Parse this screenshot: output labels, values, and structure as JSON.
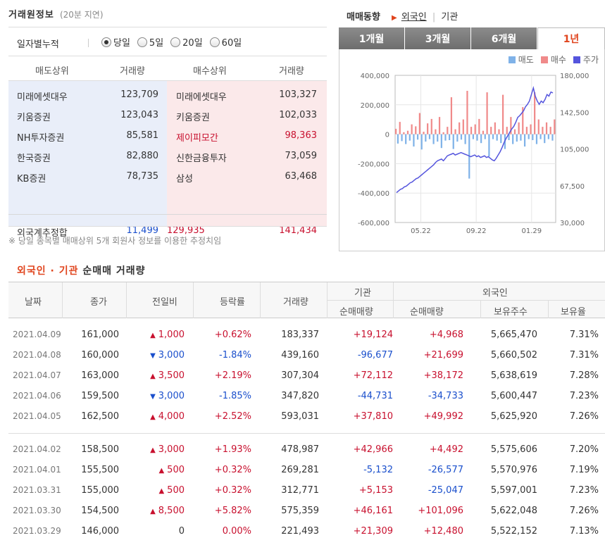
{
  "info": {
    "title": "거래원정보",
    "subtitle": "(20분 지연)",
    "period_label": "일자별누적",
    "periods": [
      {
        "label": "당일",
        "selected": true
      },
      {
        "label": "5일",
        "selected": false
      },
      {
        "label": "20일",
        "selected": false
      },
      {
        "label": "60일",
        "selected": false
      }
    ],
    "headers": {
      "sell": "매도상위",
      "sell_vol": "거래량",
      "buy": "매수상위",
      "buy_vol": "거래량"
    },
    "rows": [
      {
        "sell": "미래에셋대우",
        "sell_vol": "123,709",
        "buy": "미래에셋대우",
        "buy_vol": "103,327",
        "buy_foreign": false
      },
      {
        "sell": "키움증권",
        "sell_vol": "123,043",
        "buy": "키움증권",
        "buy_vol": "102,033",
        "buy_foreign": false
      },
      {
        "sell": "NH투자증권",
        "sell_vol": "85,581",
        "buy": "제이피모간",
        "buy_vol": "98,363",
        "buy_foreign": true
      },
      {
        "sell": "한국증권",
        "sell_vol": "82,880",
        "buy": "신한금융투자",
        "buy_vol": "73,059",
        "buy_foreign": false
      },
      {
        "sell": "KB증권",
        "sell_vol": "78,735",
        "buy": "삼성",
        "buy_vol": "63,468",
        "buy_foreign": false
      }
    ],
    "summary": {
      "label": "외국계추정합",
      "net": "11,499",
      "sell": "129,935",
      "buy": "141,434"
    },
    "note": "※ 당일 종목별 매매상위 5개 회원사 정보를 이용한 추정치임"
  },
  "trend": {
    "title": "매매동향",
    "link_foreign": "외국인",
    "link_inst": "기관",
    "tabs": [
      {
        "label": "1개월",
        "active": false
      },
      {
        "label": "3개월",
        "active": false
      },
      {
        "label": "6개월",
        "active": false
      },
      {
        "label": "1년",
        "active": true
      }
    ],
    "legend": [
      {
        "label": "매도",
        "color": "#7fb2e8"
      },
      {
        "label": "매수",
        "color": "#f08a8a"
      },
      {
        "label": "주가",
        "color": "#5555dd"
      }
    ]
  },
  "chart_data": {
    "type": "bar+line",
    "left_axis": {
      "ticks": [
        "400,000",
        "200,000",
        "0",
        "-200,000",
        "-400,000",
        "-600,000"
      ],
      "range": [
        -600000,
        400000
      ]
    },
    "right_axis": {
      "ticks": [
        "180,000",
        "142,500",
        "105,000",
        "67,500",
        "30,000"
      ],
      "range": [
        30000,
        180000
      ]
    },
    "x_ticks": [
      "05.22",
      "09.22",
      "01.29"
    ],
    "price": [
      40,
      42,
      44,
      45,
      47,
      48,
      50,
      52,
      53,
      55,
      57,
      58,
      60,
      62,
      64,
      66,
      68,
      70,
      72,
      74,
      77,
      79,
      80,
      81,
      79,
      82,
      85,
      86,
      87,
      88,
      86,
      87,
      88,
      89,
      88,
      87,
      86,
      85,
      84,
      85,
      86,
      84,
      85,
      83,
      84,
      85,
      83,
      84,
      82,
      80,
      79,
      82,
      86,
      90,
      95,
      101,
      106,
      110,
      114,
      118,
      121,
      126,
      132,
      134,
      137,
      140,
      145,
      148,
      152,
      160,
      168,
      158,
      152,
      148,
      152,
      150,
      154,
      160,
      158,
      163,
      162
    ],
    "net": [
      22,
      -38,
      50,
      -28,
      8,
      -40,
      14,
      -26,
      40,
      -50,
      32,
      -22,
      86,
      -62,
      10,
      -30,
      44,
      -20,
      62,
      -40,
      20,
      -30,
      70,
      -56,
      8,
      -26,
      30,
      -24,
      150,
      -60,
      20,
      -30,
      48,
      -22,
      60,
      -40,
      176,
      -180,
      30,
      -20,
      40,
      -26,
      62,
      -36,
      14,
      -20,
      170,
      -90,
      30,
      -20,
      48,
      -26,
      20,
      -36,
      160,
      -60,
      30,
      -24,
      70,
      -40,
      20,
      -30,
      48,
      -26,
      110,
      -50,
      30,
      -20,
      40,
      -24,
      170,
      -40,
      60,
      -20,
      30,
      -36,
      48,
      -20,
      30,
      -26,
      60
    ]
  },
  "daily": {
    "section_title_foreign": "외국인",
    "section_title_sep": "·",
    "section_title_inst": "기관",
    "section_title_rest": "순매매 거래량",
    "headers": {
      "date": "날짜",
      "close": "종가",
      "change": "전일비",
      "rate": "등락률",
      "volume": "거래량",
      "inst_group": "기관",
      "inst_net": "순매매량",
      "foreign_group": "외국인",
      "foreign_net": "순매매량",
      "holdings": "보유주수",
      "ratio": "보유율"
    },
    "rows": [
      {
        "date": "2021.04.09",
        "close": "161,000",
        "dir": "up",
        "change": "1,000",
        "rate": "+0.62%",
        "volume": "183,337",
        "inst": "+19,124",
        "foreign": "+4,968",
        "holdings": "5,665,470",
        "ratio": "7.31%"
      },
      {
        "date": "2021.04.08",
        "close": "160,000",
        "dir": "down",
        "change": "3,000",
        "rate": "-1.84%",
        "volume": "439,160",
        "inst": "-96,677",
        "foreign": "+21,699",
        "holdings": "5,660,502",
        "ratio": "7.31%"
      },
      {
        "date": "2021.04.07",
        "close": "163,000",
        "dir": "up",
        "change": "3,500",
        "rate": "+2.19%",
        "volume": "307,304",
        "inst": "+72,112",
        "foreign": "+38,172",
        "holdings": "5,638,619",
        "ratio": "7.28%"
      },
      {
        "date": "2021.04.06",
        "close": "159,500",
        "dir": "down",
        "change": "3,000",
        "rate": "-1.85%",
        "volume": "347,820",
        "inst": "-44,731",
        "foreign": "-34,733",
        "holdings": "5,600,447",
        "ratio": "7.23%"
      },
      {
        "date": "2021.04.05",
        "close": "162,500",
        "dir": "up",
        "change": "4,000",
        "rate": "+2.52%",
        "volume": "593,031",
        "inst": "+37,810",
        "foreign": "+49,992",
        "holdings": "5,625,920",
        "ratio": "7.26%"
      },
      {
        "date": "2021.04.02",
        "close": "158,500",
        "dir": "up",
        "change": "3,000",
        "rate": "+1.93%",
        "volume": "478,987",
        "inst": "+42,966",
        "foreign": "+4,492",
        "holdings": "5,575,606",
        "ratio": "7.20%"
      },
      {
        "date": "2021.04.01",
        "close": "155,500",
        "dir": "up",
        "change": "500",
        "rate": "+0.32%",
        "volume": "269,281",
        "inst": "-5,132",
        "foreign": "-26,577",
        "holdings": "5,570,976",
        "ratio": "7.19%"
      },
      {
        "date": "2021.03.31",
        "close": "155,000",
        "dir": "up",
        "change": "500",
        "rate": "+0.32%",
        "volume": "312,771",
        "inst": "+5,153",
        "foreign": "-25,047",
        "holdings": "5,597,001",
        "ratio": "7.23%"
      },
      {
        "date": "2021.03.30",
        "close": "154,500",
        "dir": "up",
        "change": "8,500",
        "rate": "+5.82%",
        "volume": "575,359",
        "inst": "+46,161",
        "foreign": "+101,096",
        "holdings": "5,622,048",
        "ratio": "7.26%"
      },
      {
        "date": "2021.03.29",
        "close": "146,000",
        "dir": "flat",
        "change": "0",
        "rate": "0.00%",
        "volume": "221,493",
        "inst": "+21,309",
        "foreign": "+12,480",
        "holdings": "5,522,152",
        "ratio": "7.13%"
      }
    ]
  }
}
